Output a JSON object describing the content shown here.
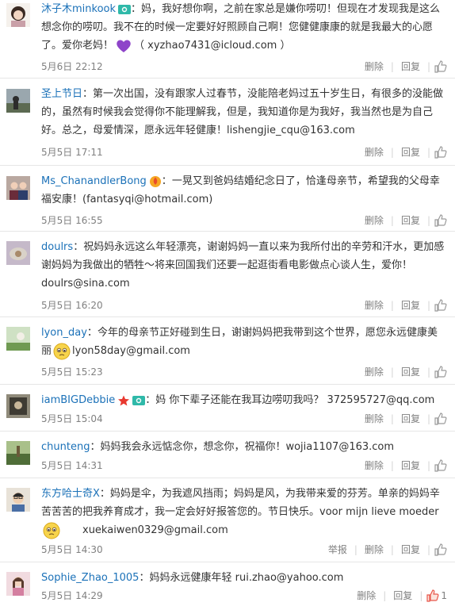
{
  "labels": {
    "delete": "删除",
    "reply": "回复",
    "report": "举报"
  },
  "comments": [
    {
      "user": "沐子木minkook",
      "text": "妈，我好想你啊，之前在家总是嫌你唠叨！但现在才发现我是这么想念你的唠叨。我不在的时候一定要好好照顾自己啊！您健健康康的就是我最大的心愿了。爱你老妈！",
      "text_after": "（ xyzhao7431@icloud.com ）",
      "time": "5月6日 22:12",
      "icons": [
        "camera-badge-icon"
      ],
      "emoji": "purple-heart-emoji-icon"
    },
    {
      "user": "圣上节日",
      "text": "第一次出国，没有跟家人过春节，没能陪老妈过五十岁生日，有很多的没能做的，虽然有时候我会觉得你不能理解我，但是，我知道你是为我好，我当然也是为自己好。总之，母爱情深，愿永远年轻健康！lishengjie_cqu@163.com",
      "time": "5月5日 17:11"
    },
    {
      "user": "Ms_ChanandlerBong",
      "text": "一晃又到爸妈结婚纪念日了，恰逢母亲节，希望我的父母幸福安康！(fantasyqi@hotmail.com)",
      "time": "5月5日 16:55",
      "icons": [
        "flame-badge-icon"
      ]
    },
    {
      "user": "doulrs",
      "text": "祝妈妈永远这么年轻漂亮，谢谢妈妈一直以来为我所付出的辛劳和汗水，更加感谢妈妈为我做出的牺牲～将来回国我们还要一起逛街看电影做点心谈人生，爱你！ doulrs@sina.com",
      "time": "5月5日 16:20"
    },
    {
      "user": "lyon_day",
      "text": "今年的母亲节正好碰到生日，谢谢妈妈把我带到这个世界，愿您永远健康美丽",
      "emoji_inline": "teary-face-emoji-icon",
      "text_after": "lyon58day@gmail.com",
      "time": "5月5日 15:23"
    },
    {
      "user": "iamBIGDebbie",
      "text": "妈 你下辈子还能在我耳边唠叨我吗？ 372595727@qq.com",
      "time": "5月5日 15:04",
      "icons": [
        "star-badge-icon",
        "camera-badge-icon"
      ]
    },
    {
      "user": "chunteng",
      "text": "妈妈我会永远惦念你，想念你，祝福你！wojia1107@163.com",
      "time": "5月5日 14:31"
    },
    {
      "user": "东方哈士奇X",
      "text": "妈妈是伞，为我遮风挡雨；妈妈是风，为我带来爱的芬芳。单亲的妈妈辛苦苦苦的把我养育成才，我一定会好好报答您的。节日快乐。voor mijn lieve moeder",
      "emoji_block": "teary-face-emoji-icon",
      "text_after": "xuekaiwen0329@gmail.com",
      "time": "5月5日 14:30",
      "show_report": true
    },
    {
      "user": "Sophie_Zhao_1005",
      "text": "妈妈永远健康年轻 rui.zhao@yahoo.com",
      "time": "5月5日 14:29",
      "likes": "1"
    }
  ]
}
